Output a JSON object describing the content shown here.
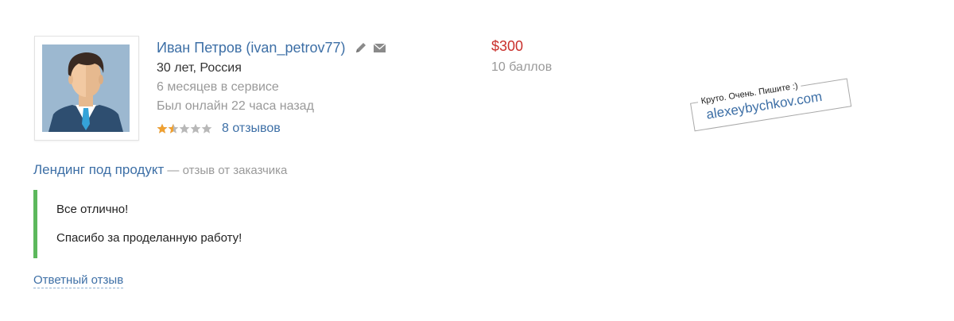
{
  "user": {
    "name": "Иван Петров (ivan_petrov77)",
    "age_country": "30 лет, Россия",
    "service_time": "6 месяцев в сервисе",
    "last_online": "Был онлайн 22 часа назад",
    "rating_stars": 1.5,
    "rating_max": 5,
    "reviews_link": "8 отзывов"
  },
  "payment": {
    "price": "$300",
    "points": "10 баллов"
  },
  "watermark": {
    "tagline": "Круто. Очень. Пишите :)",
    "site": "alexeybychkov.com"
  },
  "review": {
    "project": "Лендинг под продукт",
    "meta": " — отзыв от заказчика",
    "lines": [
      "Все отлично!",
      "Спасибо за проделанную работу!"
    ],
    "reply_link": "Ответный отзыв"
  },
  "colors": {
    "link": "#3d6fa6",
    "price": "#c9302c",
    "muted": "#999999",
    "star_filled": "#f0a030",
    "star_empty": "#b8b8b8",
    "quote_border": "#5cb85c"
  },
  "icons": {
    "edit": "pencil-icon",
    "message": "envelope-icon",
    "rating": "star-icon"
  }
}
